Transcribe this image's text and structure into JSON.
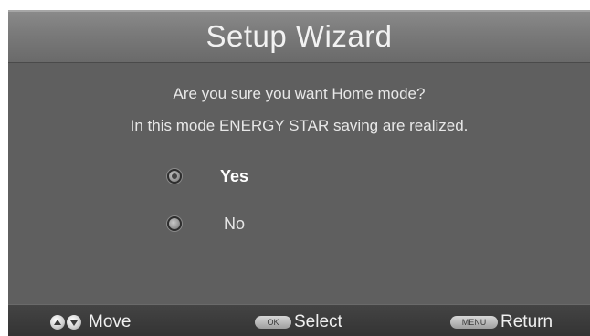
{
  "dialog": {
    "title": "Setup Wizard",
    "message_line1": "Are you sure you want Home mode?",
    "message_line2": "In this mode ENERGY STAR saving are realized.",
    "options": [
      {
        "label": "Yes",
        "selected": true
      },
      {
        "label": "No",
        "selected": false
      }
    ]
  },
  "footer": {
    "move_label": "Move",
    "ok_key": "OK",
    "select_label": "Select",
    "menu_key": "MENU",
    "return_label": "Return"
  }
}
